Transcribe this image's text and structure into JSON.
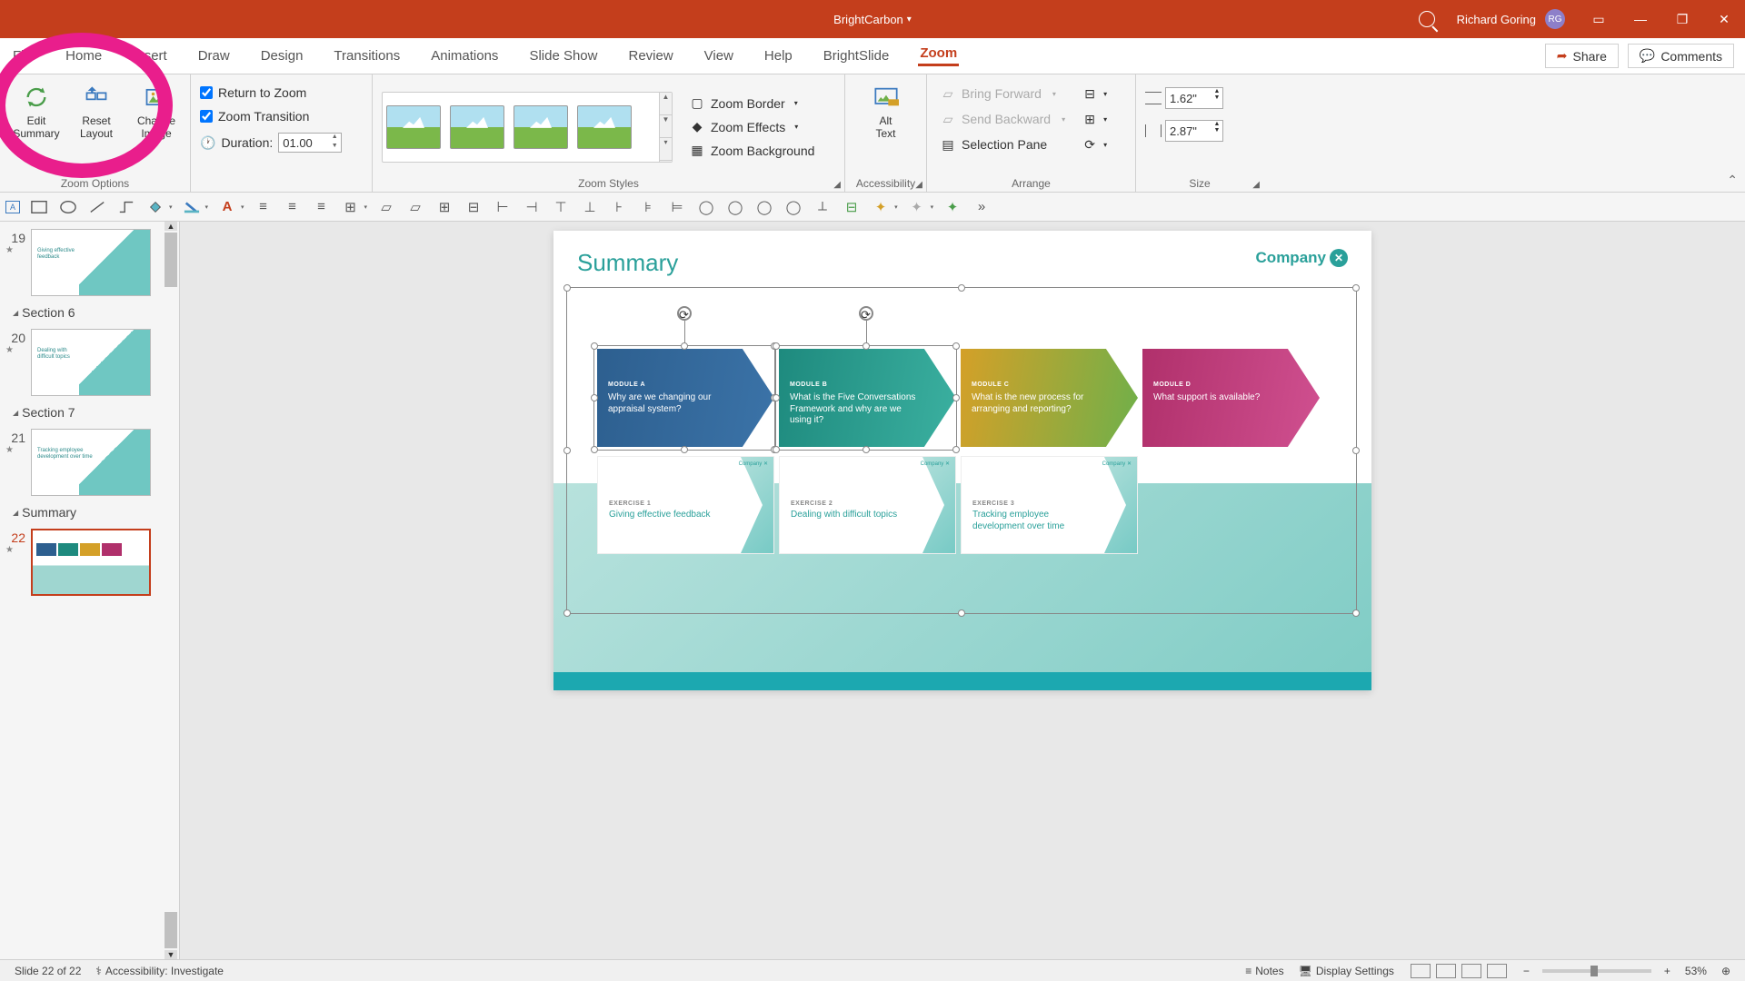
{
  "titlebar": {
    "app": "BrightCarbon",
    "user": "Richard Goring",
    "initials": "RG"
  },
  "tabs": [
    "File",
    "Home",
    "Insert",
    "Draw",
    "Design",
    "Transitions",
    "Animations",
    "Slide Show",
    "Review",
    "View",
    "Help",
    "BrightSlide",
    "Zoom"
  ],
  "active_tab": "Zoom",
  "share": "Share",
  "comments": "Comments",
  "ribbon": {
    "zoom_options": {
      "label": "Zoom Options",
      "edit": "Edit\nSummary",
      "reset": "Reset\nLayout",
      "change": "Change\nImage",
      "return": "Return to Zoom",
      "transition": "Zoom Transition",
      "duration_label": "Duration:",
      "duration": "01.00"
    },
    "styles": {
      "label": "Zoom Styles",
      "border": "Zoom Border",
      "effects": "Zoom Effects",
      "background": "Zoom Background"
    },
    "acc": {
      "label": "Accessibility",
      "alt": "Alt\nText"
    },
    "arrange": {
      "label": "Arrange",
      "forward": "Bring Forward",
      "backward": "Send Backward",
      "pane": "Selection Pane"
    },
    "size": {
      "label": "Size",
      "h": "1.62\"",
      "w": "2.87\""
    }
  },
  "thumbs": {
    "s19": {
      "num": "19",
      "t1": "Giving effective",
      "t2": "feedback"
    },
    "sec6": "Section 6",
    "s20": {
      "num": "20",
      "t1": "Dealing with",
      "t2": "difficult topics"
    },
    "sec7": "Section 7",
    "s21": {
      "num": "21",
      "t1": "Tracking employee",
      "t2": "development over time"
    },
    "sum": "Summary",
    "s22": {
      "num": "22"
    }
  },
  "slide": {
    "title": "Summary",
    "company": "Company",
    "mods": [
      {
        "lbl": "MODULE A",
        "txt": "Why are we changing our appraisal system?",
        "color": "linear-gradient(100deg,#2d5f8f,#3b73a8)"
      },
      {
        "lbl": "MODULE B",
        "txt": "What is the Five Conversations Framework and why are we using it?",
        "color": "linear-gradient(100deg,#1e8a7e,#3bb0a0)"
      },
      {
        "lbl": "MODULE C",
        "txt": "What is the new process for arranging and reporting?",
        "color": "linear-gradient(100deg,#d4a028,#6fb04a)"
      },
      {
        "lbl": "MODULE D",
        "txt": "What support is available?",
        "color": "linear-gradient(100deg,#b0306b,#d05090)"
      }
    ],
    "exs": [
      {
        "lbl": "EXERCISE 1",
        "txt": "Giving effective feedback"
      },
      {
        "lbl": "EXERCISE 2",
        "txt": "Dealing with difficult topics"
      },
      {
        "lbl": "EXERCISE 3",
        "txt": "Tracking employee development over time"
      }
    ]
  },
  "status": {
    "slide": "Slide 22 of 22",
    "acc": "Accessibility: Investigate",
    "notes": "Notes",
    "display": "Display Settings",
    "zoom": "53%"
  }
}
